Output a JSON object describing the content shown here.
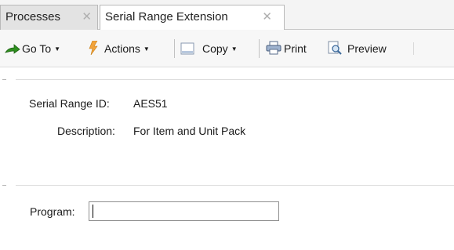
{
  "tabs": [
    {
      "label": "Processes",
      "active": false
    },
    {
      "label": "Serial Range Extension",
      "active": true
    }
  ],
  "tab_close_glyph": "✕",
  "toolbar": {
    "goto_label": "Go To",
    "actions_label": "Actions",
    "copy_label": "Copy",
    "print_label": "Print",
    "preview_label": "Preview",
    "caret": "▼"
  },
  "form": {
    "serial_range_id_label": "Serial Range ID:",
    "serial_range_id_value": "AES51",
    "description_label": "Description:",
    "description_value": "For Item and Unit Pack",
    "program_label": "Program:",
    "program_value": ""
  },
  "icons": {
    "goto": "goto-arrow-icon",
    "actions": "lightning-icon",
    "copy": "copy-icon",
    "print": "printer-icon",
    "preview": "preview-icon"
  }
}
